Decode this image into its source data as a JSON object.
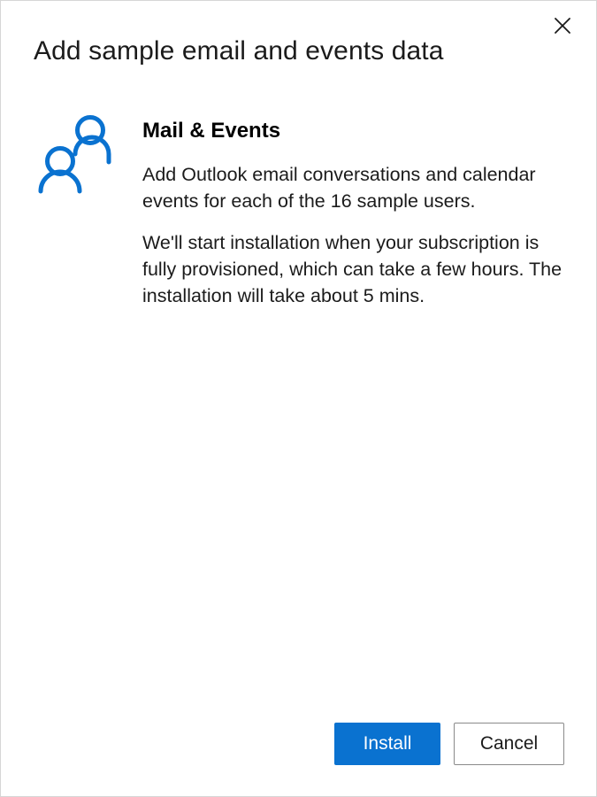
{
  "dialog": {
    "title": "Add sample email and events data",
    "close_icon": "close-icon"
  },
  "content": {
    "icon": "people-icon",
    "heading": "Mail & Events",
    "paragraphs": [
      "Add Outlook email conversations and calendar events for each of the 16 sample users.",
      "We'll start installation when your subscription is fully provisioned, which can take a few hours. The installation will take about 5 mins."
    ]
  },
  "footer": {
    "install_label": "Install",
    "cancel_label": "Cancel"
  },
  "colors": {
    "accent": "#0a72d0",
    "icon": "#0a72d0",
    "text": "#1b1b1b",
    "border": "#8a8a8a"
  }
}
